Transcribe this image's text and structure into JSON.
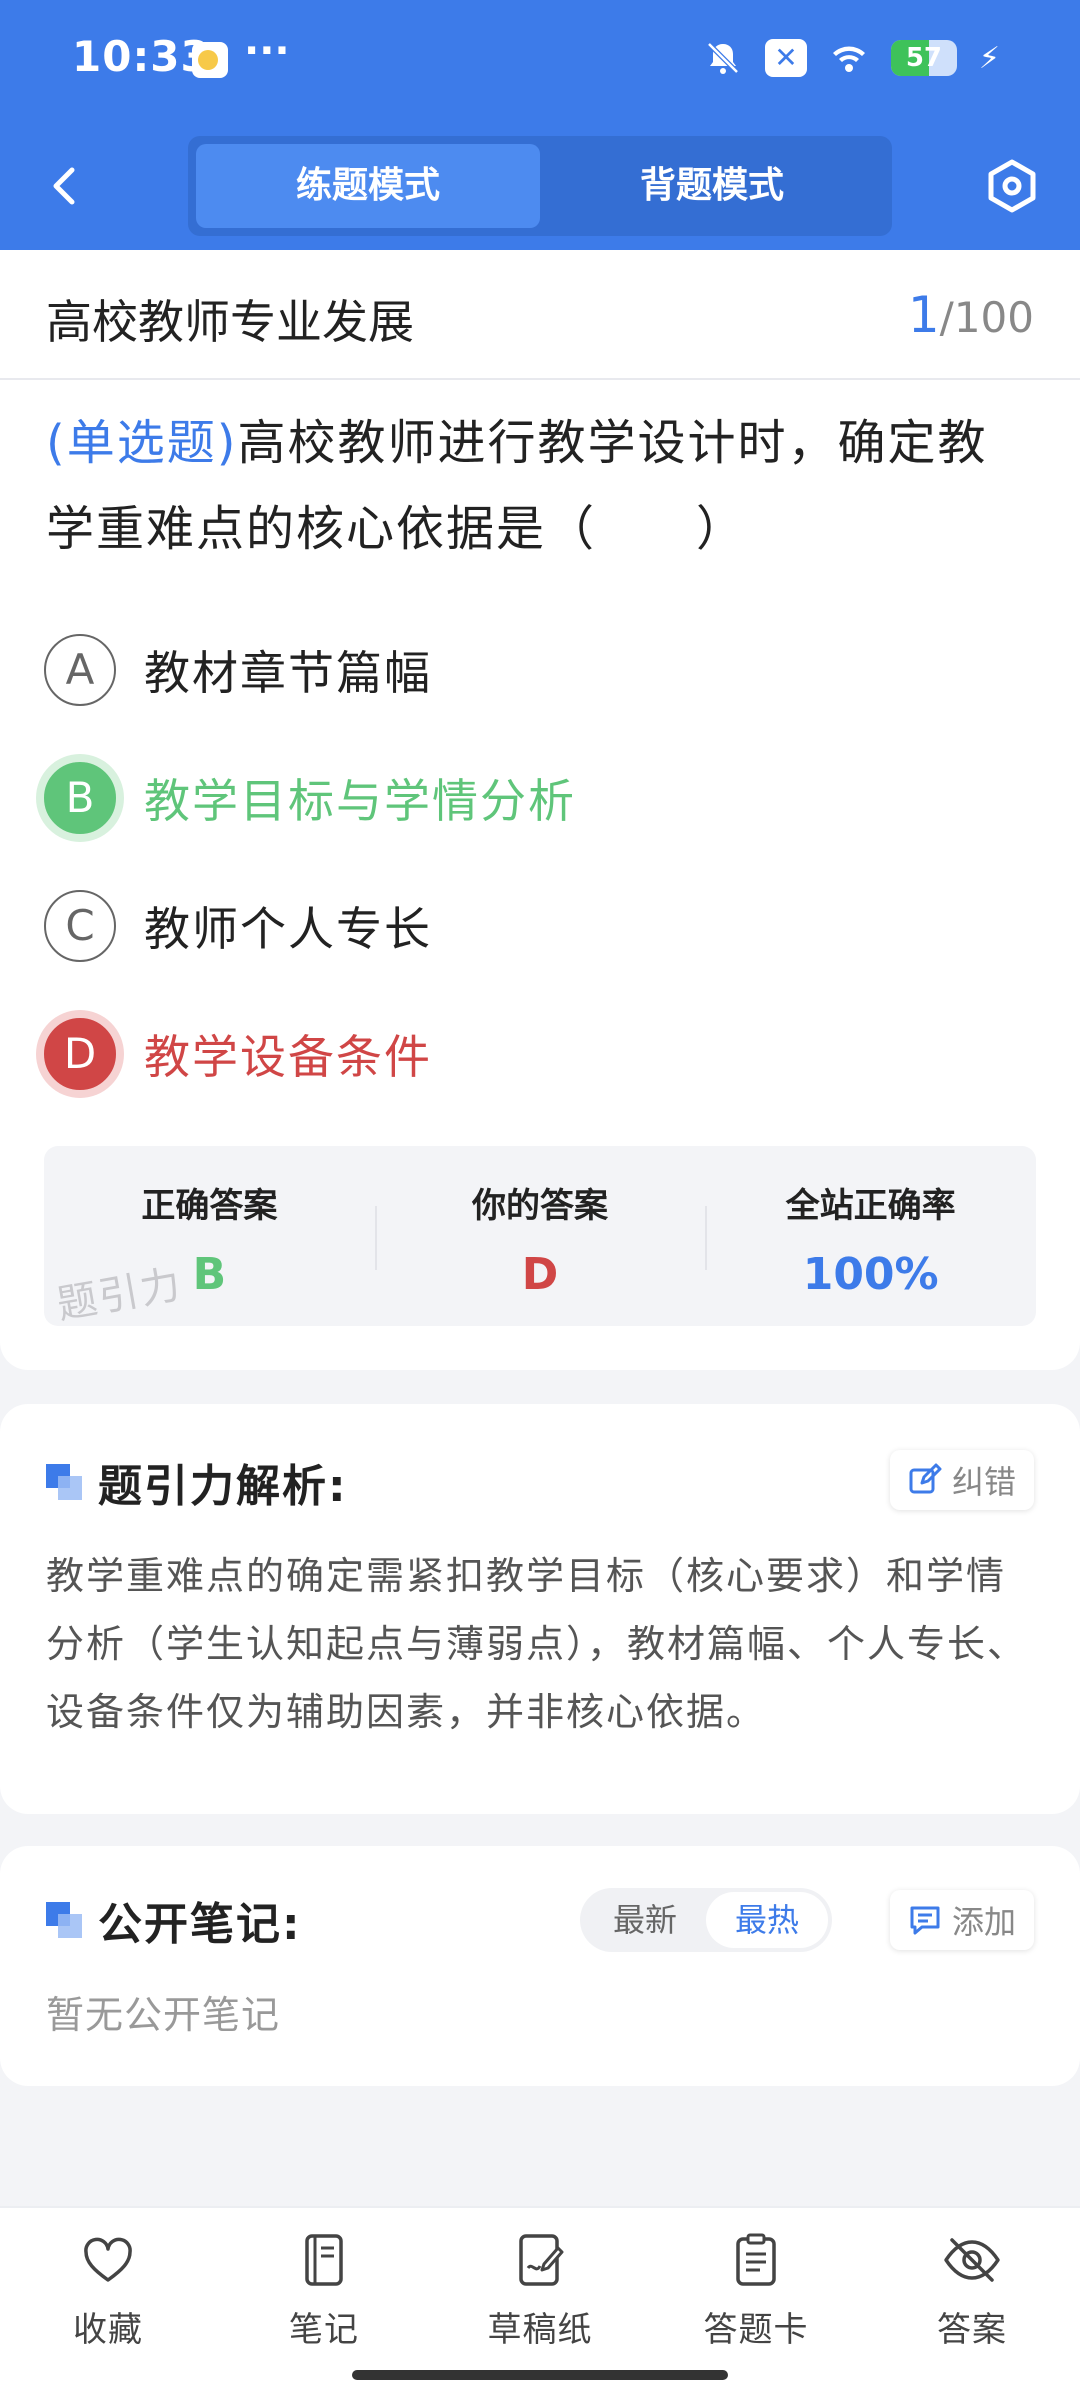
{
  "status_bar": {
    "time": "10:33",
    "more": "···",
    "battery_level": "57",
    "battery_fraction": 0.57
  },
  "nav": {
    "tabs": [
      {
        "label": "练题模式",
        "active": true
      },
      {
        "label": "背题模式",
        "active": false
      }
    ]
  },
  "question": {
    "section": "高校教师专业发展",
    "current": "1",
    "total": "/100",
    "type": "(单选题)",
    "text": "高校教师进行教学设计时，确定教学重难点的核心依据是（　　）",
    "options": [
      {
        "letter": "A",
        "text": "教材章节篇幅",
        "state": "normal"
      },
      {
        "letter": "B",
        "text": "教学目标与学情分析",
        "state": "correct"
      },
      {
        "letter": "C",
        "text": "教师个人专长",
        "state": "normal"
      },
      {
        "letter": "D",
        "text": "教学设备条件",
        "state": "wrong"
      }
    ]
  },
  "stats": {
    "correct_label": "正确答案",
    "correct_value": "B",
    "yours_label": "你的答案",
    "yours_value": "D",
    "rate_label": "全站正确率",
    "rate_value": "100%",
    "watermark": "题引力"
  },
  "analysis": {
    "title": "题引力解析:",
    "fix_label": "纠错",
    "text": "教学重难点的确定需紧扣教学目标（核心要求）和学情分析（学生认知起点与薄弱点），教材篇幅、个人专长、设备条件仅为辅助因素，并非核心依据。"
  },
  "notes": {
    "title": "公开笔记:",
    "sort_latest": "最新",
    "sort_hot": "最热",
    "add_label": "添加",
    "empty_text": "暂无公开笔记"
  },
  "bottom_bar": {
    "items": [
      {
        "label": "收藏",
        "icon": "heart-icon"
      },
      {
        "label": "笔记",
        "icon": "notebook-icon"
      },
      {
        "label": "草稿纸",
        "icon": "draft-paper-icon"
      },
      {
        "label": "答题卡",
        "icon": "answer-sheet-icon"
      },
      {
        "label": "答案",
        "icon": "eye-off-icon"
      }
    ]
  },
  "colors": {
    "primary": "#3d7be9",
    "correct": "#5fc57a",
    "wrong": "#d04646"
  }
}
